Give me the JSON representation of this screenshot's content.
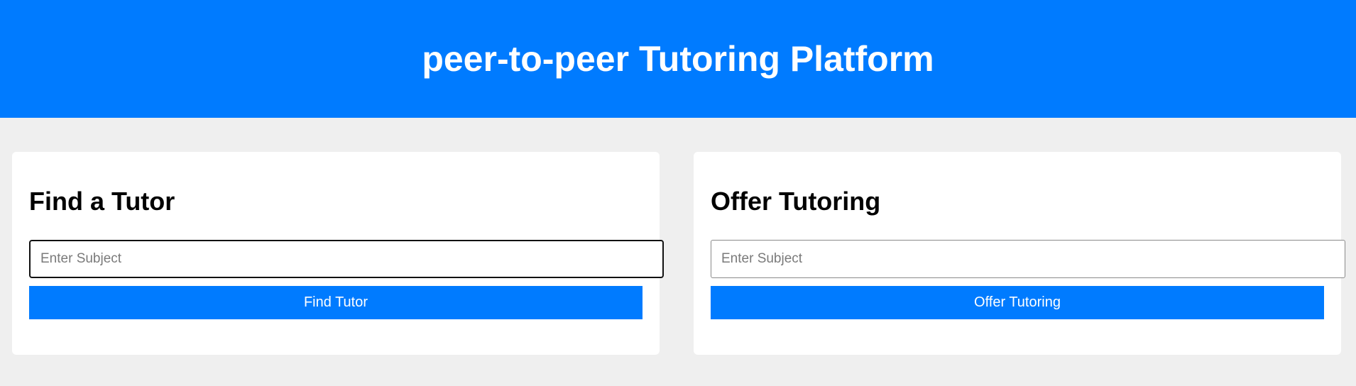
{
  "header": {
    "title": "peer-to-peer Tutoring Platform"
  },
  "find_tutor": {
    "heading": "Find a Tutor",
    "input_placeholder": "Enter Subject",
    "input_value": "",
    "button_label": "Find Tutor"
  },
  "offer_tutoring": {
    "heading": "Offer Tutoring",
    "input_placeholder": "Enter Subject",
    "input_value": "",
    "button_label": "Offer Tutoring"
  },
  "colors": {
    "brand": "#007bff",
    "page_background": "#efefef",
    "card_background": "#ffffff"
  }
}
